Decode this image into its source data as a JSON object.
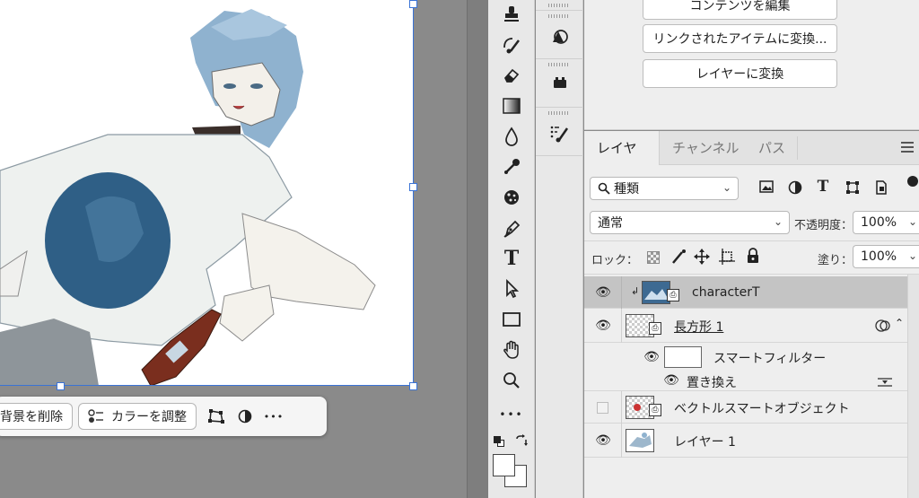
{
  "taskbar": {
    "remove_bg_label": "背景を削除",
    "adjust_color_label": "カラーを調整",
    "more_label": "•••"
  },
  "tools": {
    "more_label": "•••",
    "type_label": "T"
  },
  "properties": {
    "buttons": [
      "コンテンツを編集",
      "リンクされたアイテムに変換...",
      "レイヤーに変換"
    ]
  },
  "layers_panel": {
    "tabs": [
      "レイヤー",
      "チャンネル",
      "パス"
    ],
    "filter_kind": "種類",
    "blend_mode": "通常",
    "opacity_label": "不透明度：",
    "opacity_value": "100%",
    "lock_label": "ロック：",
    "fill_label": "塗り：",
    "fill_value": "100%",
    "layers": [
      {
        "name": "characterT",
        "visible": true,
        "selected": true,
        "clipped": true
      },
      {
        "name": "長方形 1",
        "visible": true,
        "selected": false
      },
      {
        "name": "スマートフィルター",
        "visible": true,
        "sub": true
      },
      {
        "name": "置き換え",
        "visible": true,
        "sub": true
      },
      {
        "name": "ベクトルスマートオブジェクト",
        "visible": false
      },
      {
        "name": "レイヤー 1",
        "visible": true
      }
    ]
  },
  "colors": {
    "accent_blue": "#3a73d6",
    "selected_row": "#c4c4c4",
    "panel_bg": "#eeeeee"
  }
}
